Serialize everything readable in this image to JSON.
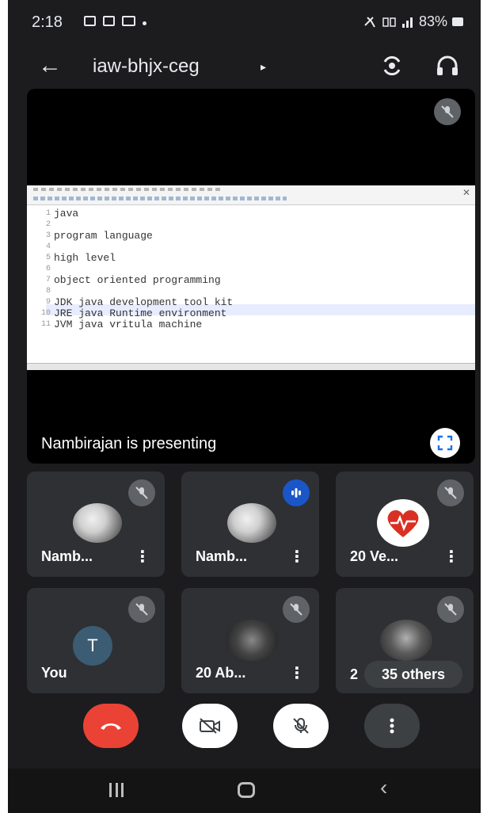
{
  "status_bar": {
    "time": "2:18",
    "right_text": "83%",
    "icons": [
      "gallery-icon",
      "message-icon",
      "mail-icon",
      "mute-icon",
      "network-icon",
      "signal-icon",
      "battery-icon"
    ]
  },
  "header": {
    "meeting_code": "iaw-bhjx-ceg",
    "caret": "▸",
    "icons": [
      "back-arrow-icon",
      "switch-camera-icon",
      "headset-icon"
    ]
  },
  "presentation": {
    "presenter_label": "Nambirajan is presenting",
    "code_lines": [
      {
        "num": "1",
        "text": "java"
      },
      {
        "num": "2",
        "text": ""
      },
      {
        "num": "3",
        "text": "program language"
      },
      {
        "num": "4",
        "text": ""
      },
      {
        "num": "5",
        "text": "high level"
      },
      {
        "num": "6",
        "text": ""
      },
      {
        "num": "7",
        "text": "object oriented programming"
      },
      {
        "num": "8",
        "text": ""
      },
      {
        "num": "9",
        "text": "JDK java development tool kit"
      },
      {
        "num": "10",
        "text": "JRE java Runtime environment"
      },
      {
        "num": "11",
        "text": "JVM java vritula machine"
      }
    ]
  },
  "participants": [
    {
      "name": "Namb...",
      "status": "muted"
    },
    {
      "name": "Namb...",
      "status": "speaking"
    },
    {
      "name": "20 Ve...",
      "status": "muted"
    },
    {
      "name": "You",
      "avatar_letter": "T",
      "status": "muted"
    },
    {
      "name": "20 Ab...",
      "status": "muted"
    },
    {
      "name": "2",
      "status": "muted",
      "overlay": "35 others"
    }
  ],
  "controls": {
    "icons": [
      "end-call-icon",
      "camera-off-icon",
      "mic-off-icon",
      "more-vert-icon"
    ]
  },
  "colors": {
    "background": "#1c1c1e",
    "tile": "#2e3034",
    "end_call": "#ea4335",
    "speaking": "#1a56c8"
  }
}
